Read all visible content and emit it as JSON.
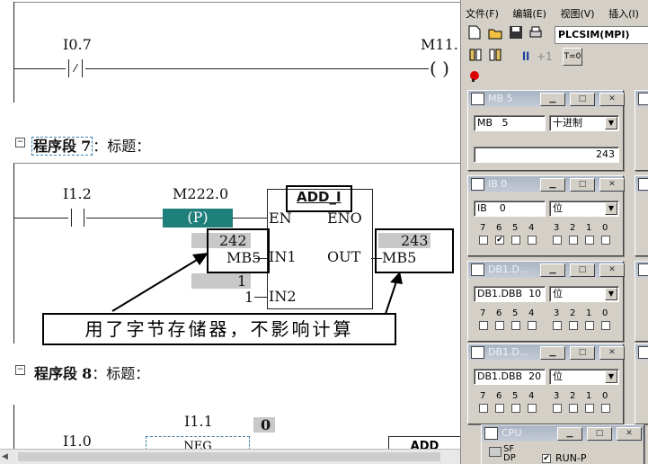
{
  "editor": {
    "network6": {
      "contact": "I0.7",
      "coil": "M11."
    },
    "network7": {
      "title_prefix": "程序段",
      "title_num": "7",
      "title_suffix": "：标题：",
      "contact": "I1.2",
      "p_coil_addr": "M222.0",
      "p_coil_label": "P",
      "block_name": "ADD_I",
      "en": "EN",
      "eno": "ENO",
      "in1_pin": "IN1",
      "in2_pin": "IN2",
      "out_pin": "OUT",
      "in1_value": "242",
      "in1_addr": "MB5",
      "in2_value": "1",
      "in2_const": "1",
      "out_value": "243",
      "out_addr": "MB5",
      "annotation": "用了字节存储器，不影响计算"
    },
    "network8": {
      "title_prefix": "程序段",
      "title_num": "8",
      "title_suffix": "：标题：",
      "contact": "I1.0",
      "contact2": "I1.1",
      "neg_value": "0",
      "neg_label": "NEG",
      "add_label": "ADD"
    }
  },
  "plcsim": {
    "menu": [
      "文件(F)",
      "编辑(E)",
      "视图(V)",
      "插入(I)"
    ],
    "toolbar": {
      "interface": "PLCSIM(MPI)",
      "plus1": "+1",
      "t0": "T=0"
    },
    "windows": [
      {
        "title": "MB   5",
        "addr": "MB",
        "addr_num": "5",
        "format": "十进制",
        "value": "243"
      },
      {
        "title": "IB   0",
        "addr": "IB",
        "addr_num": "0",
        "format": "位",
        "bits": [
          "7",
          "6",
          "5",
          "4",
          "3",
          "2",
          "1",
          "0"
        ],
        "checked": [
          false,
          true,
          false,
          false,
          false,
          false,
          false,
          false
        ]
      },
      {
        "title": "DB1.D...",
        "addr": "DB1.DBB",
        "addr_num": "10",
        "format": "位",
        "bits": [
          "7",
          "6",
          "5",
          "4",
          "3",
          "2",
          "1",
          "0"
        ],
        "checked": [
          false,
          false,
          false,
          false,
          false,
          false,
          false,
          false
        ]
      },
      {
        "title": "DB1.D...",
        "addr": "DB1.DBB",
        "addr_num": "20",
        "format": "位",
        "bits": [
          "7",
          "6",
          "5",
          "4",
          "3",
          "2",
          "1",
          "0"
        ],
        "checked": [
          false,
          false,
          false,
          false,
          false,
          false,
          false,
          false
        ]
      }
    ],
    "cpu": {
      "title": "CPU",
      "sf": "SF",
      "dp": "DP",
      "runp": "RUN-P"
    }
  }
}
